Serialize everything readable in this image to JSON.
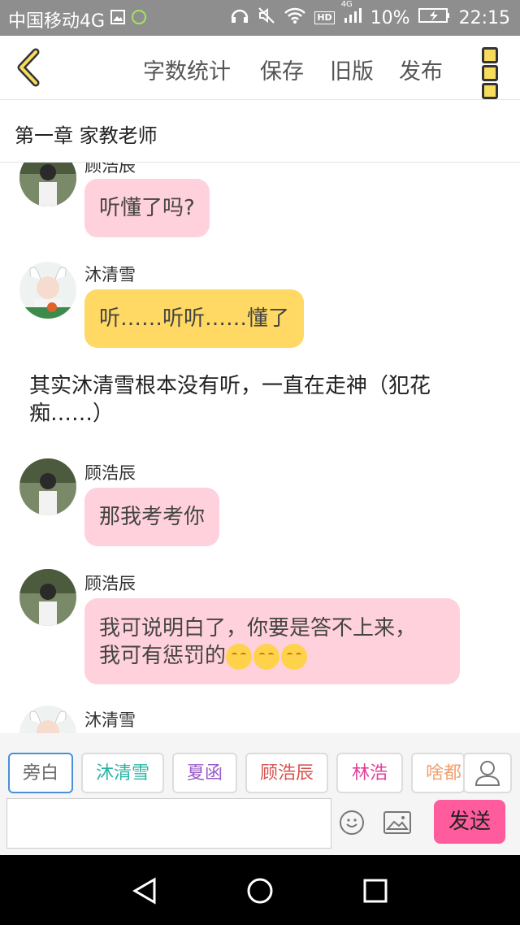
{
  "status_bar": {
    "carrier": "中国移动4G",
    "network": "4G",
    "hd": "HD",
    "battery": "10%",
    "time": "22:15"
  },
  "toolbar": {
    "word_count": "字数统计",
    "save": "保存",
    "old_version": "旧版",
    "publish": "发布"
  },
  "chapter_title": "第一章 家教老师",
  "messages": [
    {
      "name": "顾浩辰",
      "text": "听懂了吗?",
      "color": "#ffd1dc"
    },
    {
      "name": "沐清雪",
      "text": "听……听听……懂了",
      "color": "#ffd963"
    },
    {
      "narration": "其实沐清雪根本没有听，一直在走神（犯花痴……）"
    },
    {
      "name": "顾浩辰",
      "text": "那我考考你",
      "color": "#ffd1dc"
    },
    {
      "name": "顾浩辰",
      "text_line1": "我可说明白了，你要是答不上来，",
      "text_line2": "我可有惩罚的",
      "emoji": "smiling-face",
      "color": "#ffd1dc"
    },
    {
      "name": "沐清雪"
    }
  ],
  "roles": [
    {
      "label": "旁白",
      "color": "#666666"
    },
    {
      "label": "沐清雪",
      "color": "#2bb3a3"
    },
    {
      "label": "夏函",
      "color": "#9a5cc6"
    },
    {
      "label": "顾浩辰",
      "color": "#d9534f"
    },
    {
      "label": "林浩",
      "color": "#e0409a"
    },
    {
      "label": "啥都",
      "color": "#f0a070"
    }
  ],
  "input_placeholder": "",
  "send_label": "发送",
  "accent": "#ff5c9d"
}
